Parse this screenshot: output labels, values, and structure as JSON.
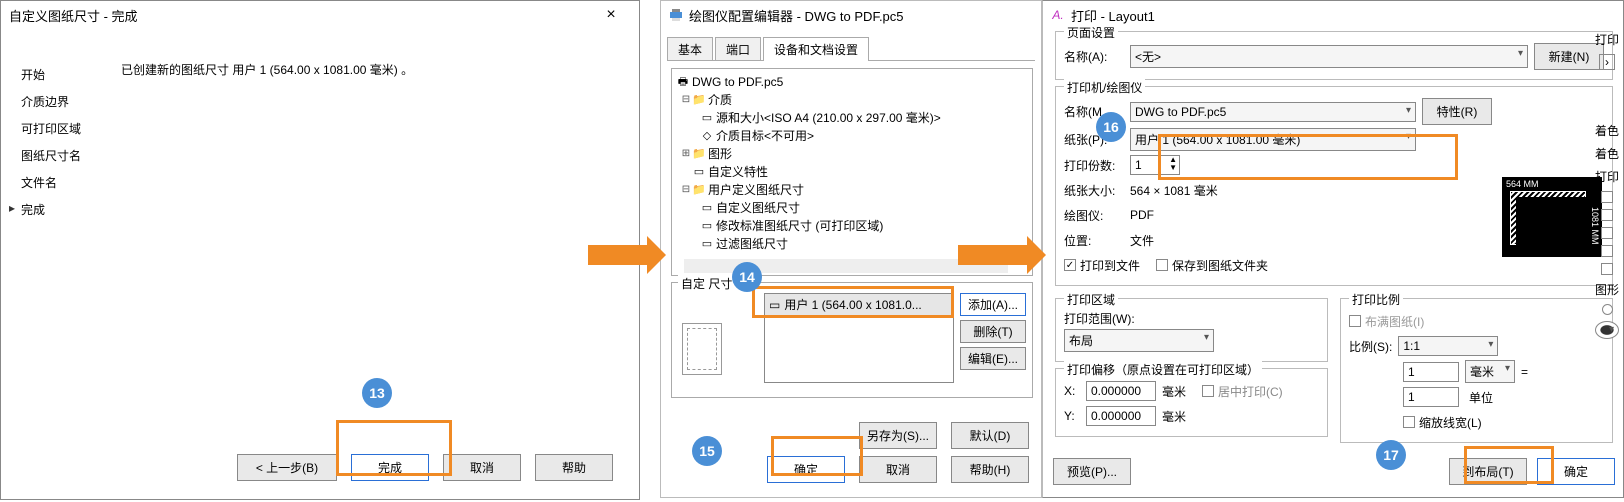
{
  "callouts": {
    "b13": "13",
    "b14": "14",
    "b15": "15",
    "b16": "16",
    "b17": "17"
  },
  "w1": {
    "title": "自定义图纸尺寸 - 完成",
    "close": "×",
    "side": [
      "开始",
      "介质边界",
      "可打印区域",
      "图纸尺寸名",
      "文件名",
      "完成"
    ],
    "msg": "已创建新的图纸尺寸 用户 1 (564.00 x 1081.00 毫米) 。",
    "back": "< 上一步(B)",
    "finish": "完成",
    "cancel": "取消",
    "help": "帮助"
  },
  "w2": {
    "title": "绘图仪配置编辑器 - DWG to PDF.pc5",
    "tabs": [
      "基本",
      "端口",
      "设备和文档设置"
    ],
    "tree": {
      "root": "DWG to PDF.pc5",
      "n_media": "介质",
      "n_src": "源和大小<ISO A4 (210.00 x 297.00 毫米)>",
      "n_tgt": "介质目标<不可用>",
      "n_graphics": "图形",
      "n_custom": "自定义特性",
      "n_userps": "用户定义图纸尺寸",
      "n_ups_custom": "自定义图纸尺寸",
      "n_ups_mod": "修改标准图纸尺寸 (可打印区域)",
      "n_ups_filter": "过滤图纸尺寸"
    },
    "custom_label": "自定         尺寸",
    "list_item": "用户 1 (564.00 x 1081.0...",
    "add": "添加(A)...",
    "del": "删除(T)",
    "edit": "编辑(E)...",
    "saveas": "另存为(S)...",
    "defaults": "默认(D)",
    "ok": "确定",
    "cancel": "取消",
    "help": "帮助(H)"
  },
  "w3": {
    "title": "打印 - Layout1",
    "strip_hdr": "打印",
    "page_setup": "页面设置",
    "name_lbl": "名称(A):",
    "name_val": "<无>",
    "new": "新建(N)",
    "printer_group": "打印机/绘图仪",
    "pname_lbl": "名称(M",
    "pname_val": "DWG to PDF.pc5",
    "props": "特性(R)",
    "paper_lbl": "纸张(P):",
    "paper_val": "用户 1 (564.00 x 1081.00 毫米)",
    "copies_lbl": "打印份数:",
    "copies_val": "1",
    "size_lbl": "纸张大小:",
    "size_val": "564 × 1081  毫米",
    "plotter_lbl": "绘图仪:",
    "plotter_val": "PDF",
    "loc_lbl": "位置:",
    "loc_val": "文件",
    "to_file": "打印到文件",
    "save_folder": "保存到图纸文件夹",
    "area_group": "打印区域",
    "range_lbl": "打印范围(W):",
    "range_val": "布局",
    "offset_group": "打印偏移（原点设置在可打印区域）",
    "x_lbl": "X:",
    "x_val": "0.000000",
    "mm": "毫米",
    "y_lbl": "Y:",
    "y_val": "0.000000",
    "center": "居中打印(C)",
    "scale_group": "打印比例",
    "fit": "布满图纸(I)",
    "scale_lbl": "比例(S):",
    "scale_val": "1:1",
    "s1": "1",
    "unit_mm": "毫米",
    "eq": "=",
    "s2": "1",
    "unit_u": "单位",
    "scale_lw": "缩放线宽(L)",
    "preview_btn": "预览(P)...",
    "apply_layout": "到布局(T)",
    "ok": "确定",
    "pv_w": "564 MM",
    "pv_h": "1081 MM",
    "right": {
      "l1": "着色",
      "l2": "着色",
      "l3": "打印",
      "l4": "图形"
    }
  }
}
